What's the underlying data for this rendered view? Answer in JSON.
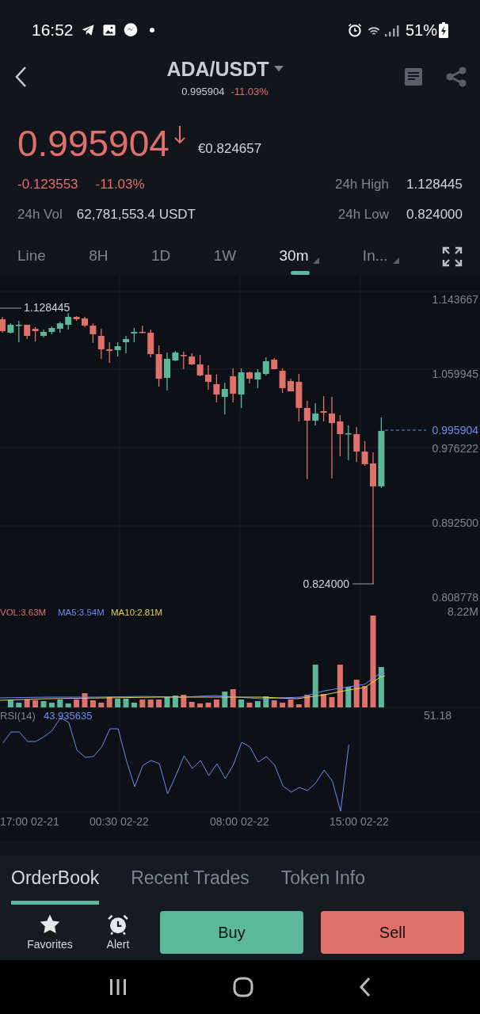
{
  "status_bar": {
    "time": "16:52",
    "battery": "51%"
  },
  "header": {
    "title": "ADA/USDT",
    "price": "0.995904",
    "change": "-11.03%"
  },
  "ticker": {
    "price": "0.995904",
    "fiat_price": "€0.824657",
    "change": "-0.123553",
    "change_percent": "-11.03%",
    "stats": [
      {
        "label": "24h High",
        "value": "1.128445"
      },
      {
        "label": "24h Low",
        "value": "0.824000"
      }
    ],
    "volume_label": "24h Vol",
    "volume": "62,781,553.4 USDT"
  },
  "intervals": [
    {
      "label": "Line",
      "selected": false,
      "has_menu": false
    },
    {
      "label": "8H",
      "selected": false,
      "has_menu": false
    },
    {
      "label": "1D",
      "selected": false,
      "has_menu": false
    },
    {
      "label": "1W",
      "selected": false,
      "has_menu": false
    },
    {
      "label": "30m",
      "selected": true,
      "has_menu": true
    },
    {
      "label": "In...",
      "selected": false,
      "has_menu": true
    }
  ],
  "chart": {
    "chart_data": {
      "type": "candlestick",
      "ylim": [
        0.808778,
        1.143667
      ],
      "yticks": [
        {
          "value": 1.143667,
          "label": "1.143667"
        },
        {
          "value": 1.059945,
          "label": "1.059945"
        },
        {
          "value": 0.976222,
          "label": "0.976222"
        },
        {
          "value": 0.8925,
          "label": "0.892500"
        },
        {
          "value": 0.808778,
          "label": "0.808778"
        }
      ],
      "categories": [
        null,
        null,
        null,
        null,
        null,
        null,
        null,
        null,
        null,
        null,
        null,
        null,
        null,
        null,
        null,
        null,
        null,
        null,
        null,
        null,
        null,
        null,
        null,
        null,
        null,
        null,
        null,
        null,
        null,
        null,
        null,
        null,
        null,
        null,
        null,
        null,
        null,
        null,
        null,
        null,
        null,
        null,
        null,
        null,
        null,
        null,
        null
      ],
      "ohlc": [
        [
          1.1214,
          1.1241,
          1.1063,
          1.108
        ],
        [
          1.1063,
          1.1169,
          1.1054,
          1.1152
        ],
        [
          1.1143,
          1.1196,
          1.0956,
          1.1152
        ],
        [
          1.1152,
          1.1152,
          1.0991,
          1.1027
        ],
        [
          1.1107,
          1.1125,
          1.0965,
          1.108
        ],
        [
          1.1027,
          1.1098,
          1.1009,
          1.1072
        ],
        [
          1.1072,
          1.1134,
          1.1045,
          1.1116
        ],
        [
          1.1107,
          1.1187,
          1.1063,
          1.1169
        ],
        [
          1.1152,
          1.1284,
          1.1098,
          1.1241
        ],
        [
          1.1241,
          1.125,
          1.1196,
          1.1214
        ],
        [
          1.1223,
          1.1241,
          1.1125,
          1.1143
        ],
        [
          1.1143,
          1.1169,
          1.0947,
          1.1045
        ],
        [
          1.1027,
          1.1107,
          1.0769,
          1.0876
        ],
        [
          1.0876,
          1.0956,
          1.0724,
          1.0858
        ],
        [
          1.0867,
          1.0956,
          1.0795,
          1.0911
        ],
        [
          1.0956,
          1.1027,
          1.0831,
          1.0991
        ],
        [
          1.1054,
          1.1116,
          1.0956,
          1.1072
        ],
        [
          1.1072,
          1.1143,
          1.1054,
          1.1063
        ],
        [
          1.1063,
          1.1098,
          1.0786,
          1.0822
        ],
        [
          1.0822,
          1.092,
          1.0457,
          1.0546
        ],
        [
          1.0555,
          1.084,
          1.0412,
          1.0769
        ],
        [
          1.0751,
          1.0858,
          1.0742,
          1.084
        ],
        [
          1.0813,
          1.0849,
          1.0653,
          1.0804
        ],
        [
          1.0795,
          1.0831,
          1.0697,
          1.0706
        ],
        [
          1.0706,
          1.0813,
          1.0573,
          1.0582
        ],
        [
          1.0591,
          1.0697,
          1.0421,
          1.051
        ],
        [
          1.0484,
          1.0591,
          1.0279,
          1.0368
        ],
        [
          1.0341,
          1.0501,
          1.0145,
          1.043
        ],
        [
          1.0573,
          1.0662,
          1.0279,
          1.0377
        ],
        [
          1.0368,
          1.0662,
          1.0217,
          1.0617
        ],
        [
          1.0617,
          1.0626,
          1.0493,
          1.0546
        ],
        [
          1.0537,
          1.0653,
          1.0439,
          1.0617
        ],
        [
          1.0599,
          1.0786,
          1.0582,
          1.0742
        ],
        [
          1.076,
          1.0778,
          1.0653,
          1.0653
        ],
        [
          1.0635,
          1.0662,
          1.0386,
          1.0439
        ],
        [
          1.0519,
          1.0546,
          1.0403,
          1.0403
        ],
        [
          1.051,
          1.0599,
          1.0065,
          1.0217
        ],
        [
          1.0217,
          1.0297,
          0.9415,
          1.0074
        ],
        [
          1.0074,
          1.027,
          1.0021,
          1.0154
        ],
        [
          1.0181,
          1.035,
          1.0065,
          1.0163
        ],
        [
          1.0154,
          1.0341,
          0.9424,
          1.0047
        ],
        [
          1.0065,
          1.0136,
          0.9674,
          0.9923
        ],
        [
          0.9923,
          1.0021,
          0.9629,
          0.9932
        ],
        [
          0.9923,
          1.0003,
          0.9611,
          0.9727
        ],
        [
          0.9727,
          0.9843,
          0.9566,
          0.9584
        ],
        [
          0.9593,
          0.9718,
          0.824,
          0.9335
        ],
        [
          0.9335,
          1.011,
          0.9317,
          0.9959
        ]
      ]
    },
    "current_price": "0.995904",
    "high_marker": "1.128445",
    "low_marker": "0.824000",
    "volume_legend": [
      {
        "label": "VOL:3.63M",
        "color": "#e0706a"
      },
      {
        "label": "MA5:3.54M",
        "color": "#6c8df0"
      },
      {
        "label": "MA10:2.81M",
        "color": "#e8d04a"
      }
    ],
    "volume_max": "8.22M",
    "rsi_label": "RSI(14)",
    "rsi_value": "43.935635",
    "rsi_max": "51.18",
    "time_axis": [
      "17:00 02-21",
      "00:30 02-22",
      "08:00 02-22",
      "15:00 02-22"
    ]
  },
  "bottom_tabs": [
    {
      "label": "OrderBook",
      "selected": true
    },
    {
      "label": "Recent Trades",
      "selected": false
    },
    {
      "label": "Token Info",
      "selected": false
    }
  ],
  "actions": [
    {
      "label": "Favorites",
      "kind": "star"
    },
    {
      "label": "Alert",
      "kind": "alarm"
    }
  ],
  "trade_buttons": [
    {
      "label": "Buy",
      "kind": "buy"
    },
    {
      "label": "Sell",
      "kind": "sell"
    }
  ]
}
